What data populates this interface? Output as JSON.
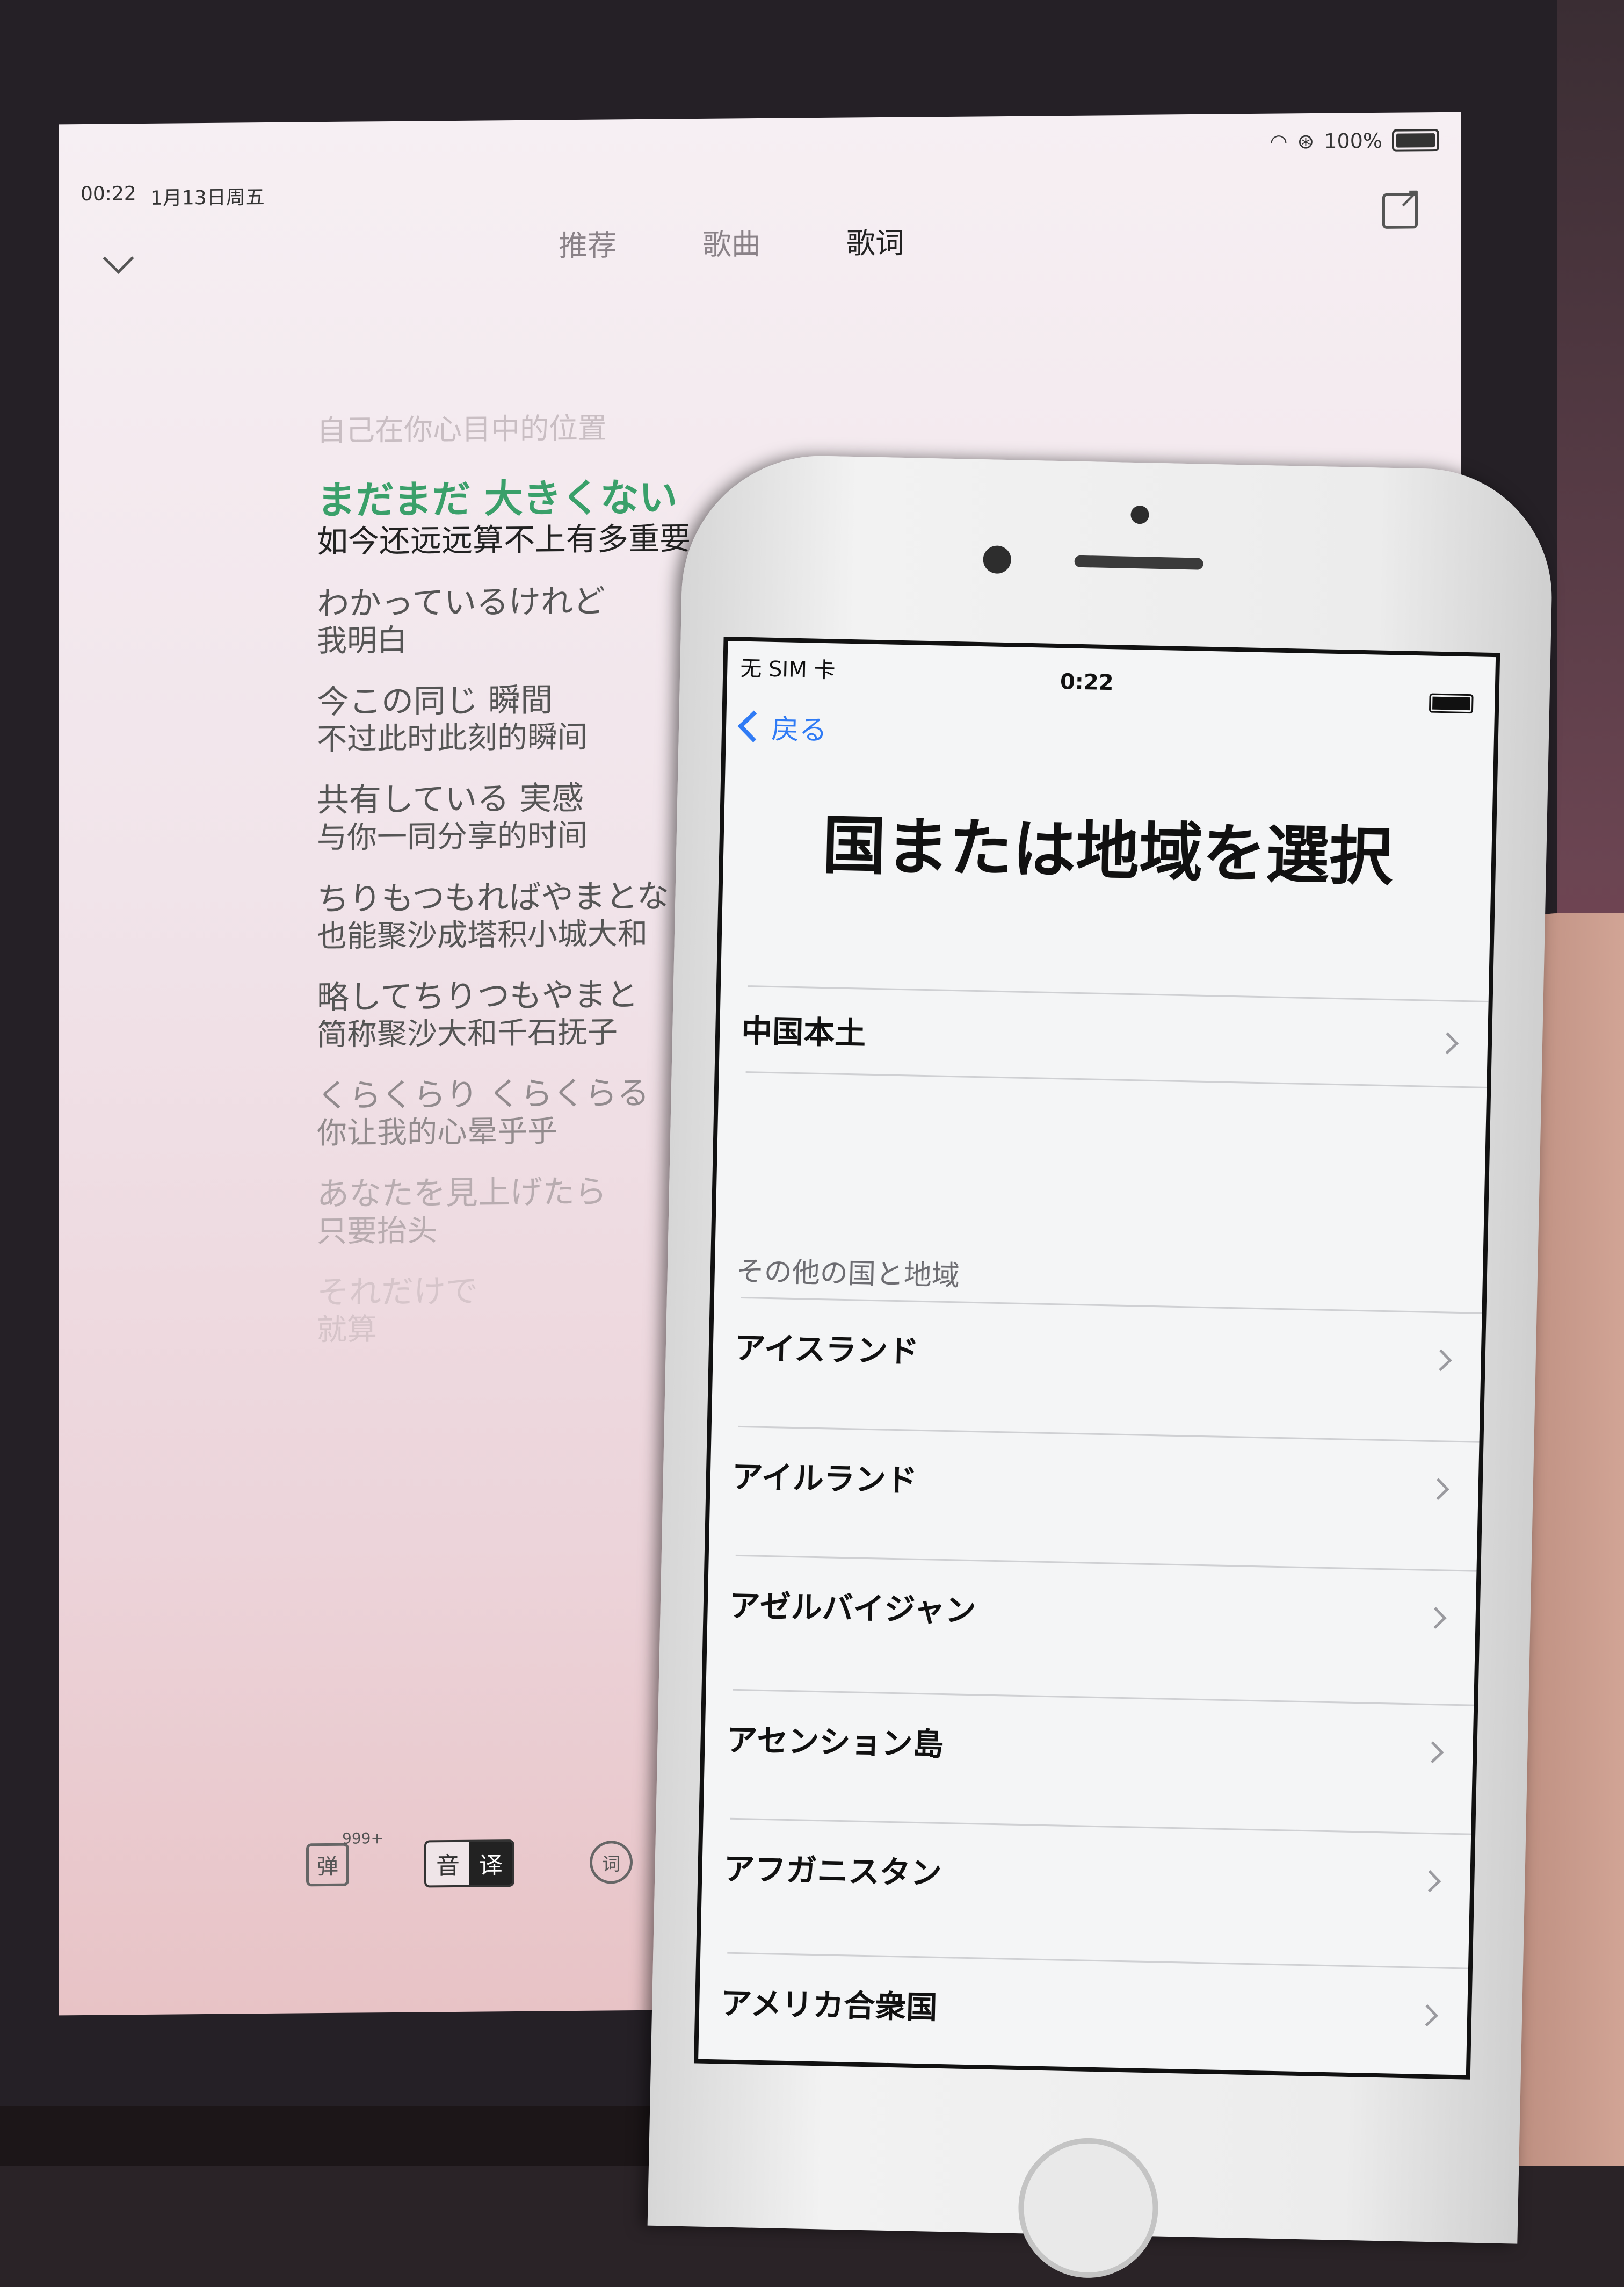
{
  "ipad": {
    "status_time": "00:22",
    "status_date": "1月13日周五",
    "battery": "100%",
    "tabs": [
      "推荐",
      "歌曲",
      "歌词"
    ],
    "lyrics": {
      "faded_top": "自己在你心目中的位置",
      "current_ja": "まだまだ 大きくない",
      "current_zh": "如今还远远算不上有多重要",
      "lines": [
        {
          "ja": "わかっているけれど",
          "zh": "我明白"
        },
        {
          "ja": "今この同じ 瞬間",
          "zh": "不过此时此刻的瞬间"
        },
        {
          "ja": "共有している 実感",
          "zh": "与你一同分享的时间"
        },
        {
          "ja": "ちりもつもればやまとな",
          "zh": "也能聚沙成塔积小城大和"
        },
        {
          "ja": "略してちりつもやまと",
          "zh": "简称聚沙大和千石抚子"
        },
        {
          "ja": "くらくらり くらくらる",
          "zh": "你让我的心晕乎乎"
        },
        {
          "ja": "あなたを見上げたら",
          "zh": "只要抬头"
        },
        {
          "ja": "それだけで",
          "zh": "就算"
        }
      ]
    },
    "controls": {
      "danmaku": "弹",
      "danmaku_count": "999+",
      "yin": "音",
      "yi": "译",
      "ci": "词"
    }
  },
  "iphone": {
    "carrier": "无 SIM 卡",
    "time": "0:22",
    "back_label": "戻る",
    "title": "国または地域を選択",
    "primary_region": "中国本土",
    "section_header": "その他の国と地域",
    "regions": [
      "アイスランド",
      "アイルランド",
      "アゼルバイジャン",
      "アセンション島",
      "アフガニスタン",
      "アメリカ合衆国"
    ]
  }
}
